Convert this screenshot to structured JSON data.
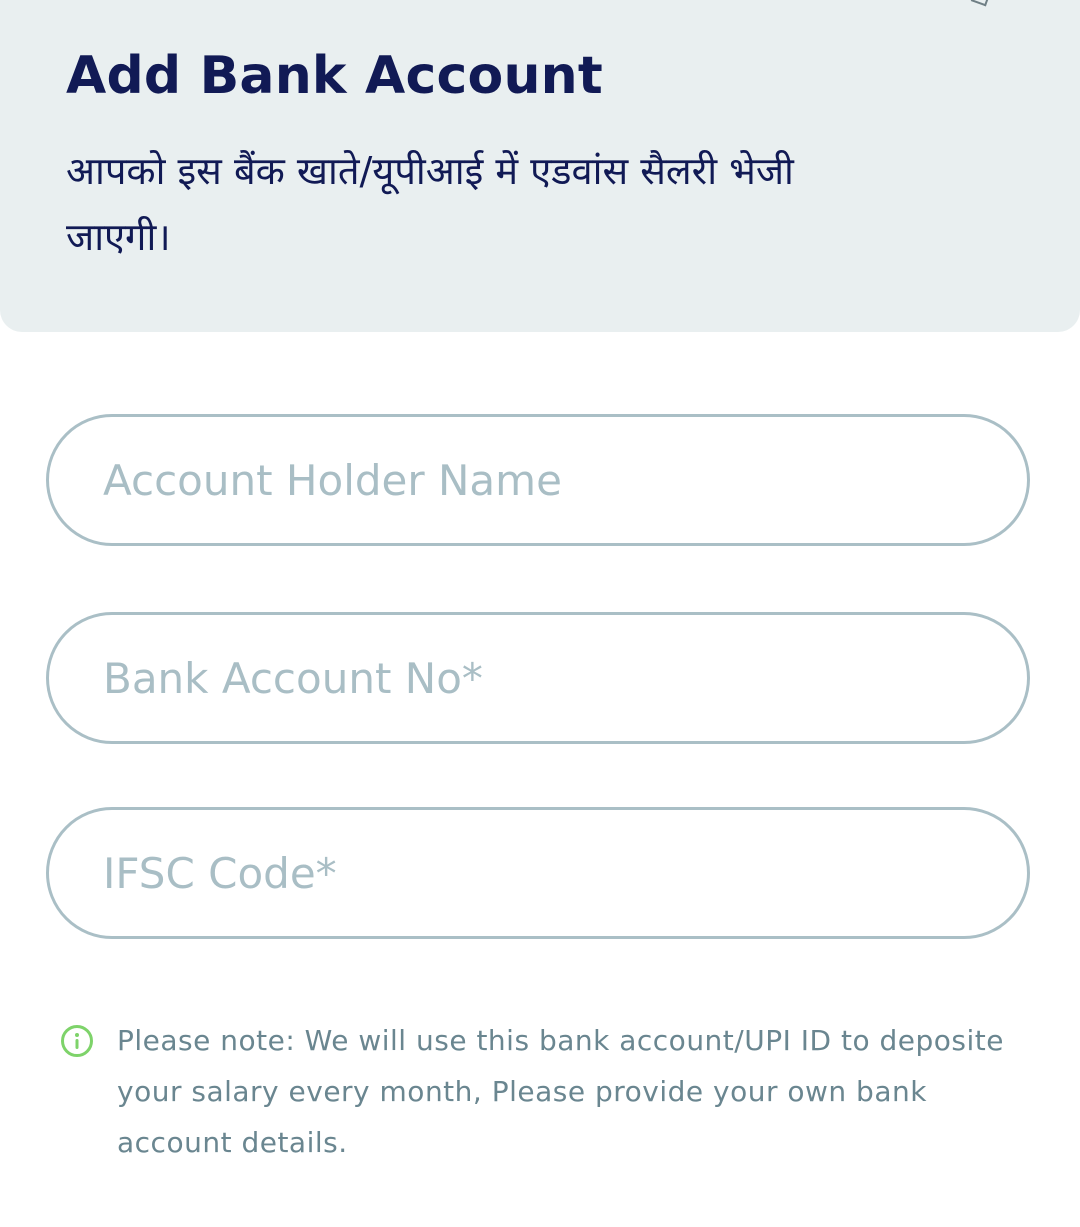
{
  "header": {
    "title": "Add Bank Account",
    "subtitle": "आपको इस बैंक खाते/यूपीआई में एडवांस सैलरी भेजी जाएगी।"
  },
  "form": {
    "fields": [
      {
        "placeholder": "Account Holder Name",
        "value": ""
      },
      {
        "placeholder": "Bank Account No*",
        "value": ""
      },
      {
        "placeholder": "IFSC Code*",
        "value": ""
      }
    ]
  },
  "note": {
    "icon": "info-icon",
    "text": "Please note: We will use this bank account/UPI ID to deposite your salary every month, Please provide your own bank account details."
  },
  "colors": {
    "header_bg": "#e9eff0",
    "title": "#111a55",
    "field_border": "#aabfc6",
    "placeholder": "#a9bec5",
    "note_text": "#6a8690",
    "info_icon": "#7ed36a"
  }
}
